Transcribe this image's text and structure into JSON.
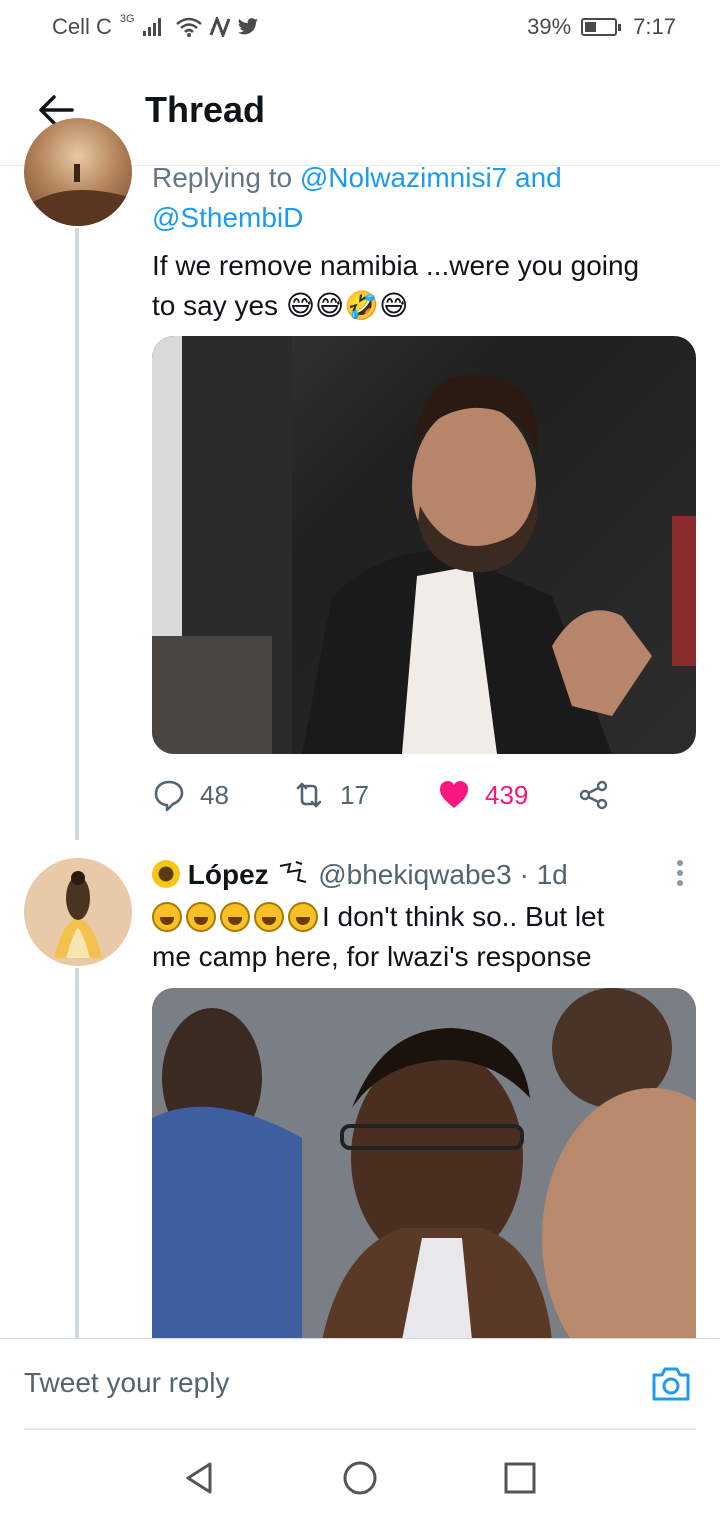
{
  "status_bar": {
    "carrier": "Cell C",
    "network": "3G",
    "battery": "39%",
    "battery_level": 0.39,
    "time": "7:17"
  },
  "header": {
    "title": "Thread",
    "back_icon": "arrow-left-icon"
  },
  "tweet1": {
    "replying_label": "Replying to",
    "mention1": "@Nolwazimnisi7",
    "and_label": "and",
    "mention2": "@SthembiD",
    "text_line1": "If we remove namibia ...were you going",
    "text_line2": "to say yes",
    "emoji_trail": "😅😅🤣😅",
    "media_alt": "man shrugging meme",
    "replies": "48",
    "retweets": "17",
    "likes": "439",
    "liked": true,
    "like_color": "#f91880"
  },
  "tweet2": {
    "name": "López",
    "handle": "@bhekiqwabe3",
    "separator": "·",
    "time": "1d",
    "text_line1": "I don't think so.. But let",
    "text_line2": "me camp here, for lwazi's response",
    "media_alt": "man in glasses smirking meme"
  },
  "reply_bar": {
    "placeholder": "Tweet your reply",
    "camera_icon": "camera-icon"
  },
  "nav": {
    "back": "nav-back-icon",
    "home": "nav-home-icon",
    "recents": "nav-recents-icon"
  },
  "colors": {
    "accent": "#1d9bf0",
    "like": "#f91880",
    "muted": "#536471"
  }
}
